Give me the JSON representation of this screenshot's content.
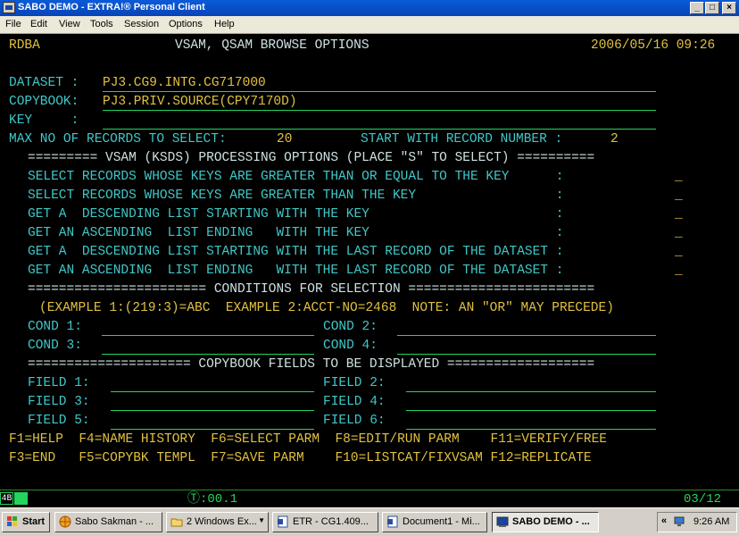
{
  "window": {
    "title": "SABO DEMO - EXTRA!® Personal Client",
    "buttons": {
      "minimize": "_",
      "maximize": "□",
      "close": "×"
    }
  },
  "menu": [
    "File",
    "Edit",
    "View",
    "Tools",
    "Session",
    "Options",
    "Help"
  ],
  "screen": {
    "id": "RDBA",
    "title": "VSAM, QSAM BROWSE OPTIONS",
    "datetime": "2006/05/16 09:26",
    "dataset_label": "DATASET :",
    "dataset_value": "PJ3.CG9.INTG.CG717000",
    "copybook_label": "COPYBOOK:",
    "copybook_value": "PJ3.PRIV.SOURCE(CPY7170D)",
    "key_label": "KEY     :",
    "key_value": "",
    "max_records_label": "MAX NO OF RECORDS TO SELECT:",
    "max_records_value": "20",
    "start_record_label": "START WITH RECORD NUMBER :",
    "start_record_value": "2",
    "ksds_header": "========= VSAM (KSDS) PROCESSING OPTIONS (PLACE \"S\" TO SELECT) ==========",
    "options": [
      {
        "label": "SELECT RECORDS WHOSE KEYS ARE GREATER THAN OR EQUAL TO THE KEY      :",
        "value": "_"
      },
      {
        "label": "SELECT RECORDS WHOSE KEYS ARE GREATER THAN THE KEY                  :",
        "value": "_"
      },
      {
        "label": "GET A  DESCENDING LIST STARTING WITH THE KEY                        :",
        "value": "_"
      },
      {
        "label": "GET AN ASCENDING  LIST ENDING   WITH THE KEY                        :",
        "value": "_"
      },
      {
        "label": "GET A  DESCENDING LIST STARTING WITH THE LAST RECORD OF THE DATASET :",
        "value": "_"
      },
      {
        "label": "GET AN ASCENDING  LIST ENDING   WITH THE LAST RECORD OF THE DATASET :",
        "value": "_"
      }
    ],
    "conditions_header": "======================= CONDITIONS FOR SELECTION ========================",
    "conditions_example": "(EXAMPLE 1:(219:3)=ABC  EXAMPLE 2:ACCT-NO=2468  NOTE: AN \"OR\" MAY PRECEDE)",
    "conditions": [
      "COND 1:",
      "COND 2:",
      "COND 3:",
      "COND 4:"
    ],
    "fields_header": "===================== COPYBOOK FIELDS TO BE DISPLAYED ===================",
    "fields": [
      "FIELD 1:",
      "FIELD 2:",
      "FIELD 3:",
      "FIELD 4:",
      "FIELD 5:",
      "FIELD 6:"
    ],
    "pf_row1": "F1=HELP  F4=NAME HISTORY  F6=SELECT PARM  F8=EDIT/RUN PARM    F11=VERIFY/FREE",
    "pf_row2": "F3=END   F5=COPYBK TEMPL  F7=SAVE PARM    F10=LISTCAT/FIXVSAM F12=REPLICATE"
  },
  "status": {
    "session_tag": "4B",
    "timer": "Ⓣ:00.1",
    "cursor_pos": "03/12"
  },
  "taskbar": {
    "start": "Start",
    "buttons": [
      "Sabo Sakman - ...",
      "2 Windows Ex...",
      "ETR - CG1.409...",
      "Document1 - Mi...",
      "SABO DEMO - ..."
    ],
    "tray_chevron": "«",
    "clock": "9:26 AM"
  },
  "colors": {
    "terminal_bg": "#000000",
    "protected_text": "#3fc8c8",
    "input_text": "#e0c040",
    "field_underline": "#24d45e",
    "titlebar": "#0a5bd8"
  }
}
